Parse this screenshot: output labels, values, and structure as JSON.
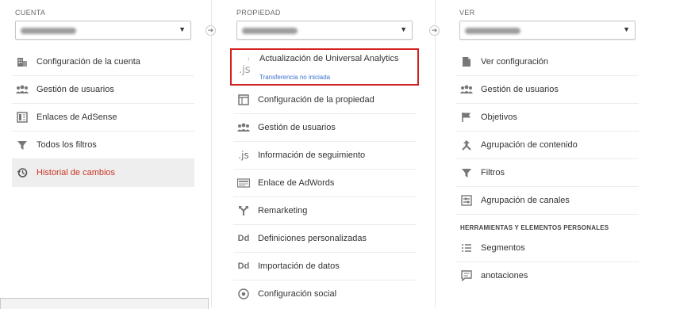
{
  "cuenta": {
    "header": "CUENTA",
    "items": [
      {
        "label": "Configuración de la cuenta",
        "icon": "building-icon"
      },
      {
        "label": "Gestión de usuarios",
        "icon": "users-icon"
      },
      {
        "label": "Enlaces de AdSense",
        "icon": "adsense-icon"
      },
      {
        "label": "Todos los filtros",
        "icon": "filter-icon"
      },
      {
        "label": "Historial de cambios",
        "icon": "history-icon",
        "active": true
      }
    ]
  },
  "propiedad": {
    "header": "PROPIEDAD",
    "highlight": {
      "title": "Actualización de Universal Analytics",
      "status": "Transferencia no iniciada",
      "icon_text": ".js"
    },
    "items": [
      {
        "label": "Configuración de la propiedad",
        "icon": "window-icon"
      },
      {
        "label": "Gestión de usuarios",
        "icon": "users-icon"
      },
      {
        "label": "Información de seguimiento",
        "icon": "js-icon",
        "icon_text": ".js"
      },
      {
        "label": "Enlace de AdWords",
        "icon": "adwords-icon"
      },
      {
        "label": "Remarketing",
        "icon": "remarketing-icon"
      },
      {
        "label": "Definiciones personalizadas",
        "icon": "dd-icon",
        "icon_text": "Dd"
      },
      {
        "label": "Importación de datos",
        "icon": "dd-icon",
        "icon_text": "Dd"
      },
      {
        "label": "Configuración social",
        "icon": "social-icon"
      }
    ]
  },
  "ver": {
    "header": "VER",
    "items": [
      {
        "label": "Ver configuración",
        "icon": "document-icon"
      },
      {
        "label": "Gestión de usuarios",
        "icon": "users-icon"
      },
      {
        "label": "Objetivos",
        "icon": "flag-icon"
      },
      {
        "label": "Agrupación de contenido",
        "icon": "grouping-icon"
      },
      {
        "label": "Filtros",
        "icon": "filter-icon"
      },
      {
        "label": "Agrupación de canales",
        "icon": "channels-icon"
      }
    ],
    "section_header": "HERRAMIENTAS Y ELEMENTOS PERSONALES",
    "tools": [
      {
        "label": "Segmentos",
        "icon": "segments-icon"
      },
      {
        "label": "anotaciones",
        "icon": "annotations-icon"
      }
    ]
  },
  "colors": {
    "active_text": "#c93425",
    "highlight_border": "#d31f1f",
    "status_link": "#3b70ce"
  }
}
